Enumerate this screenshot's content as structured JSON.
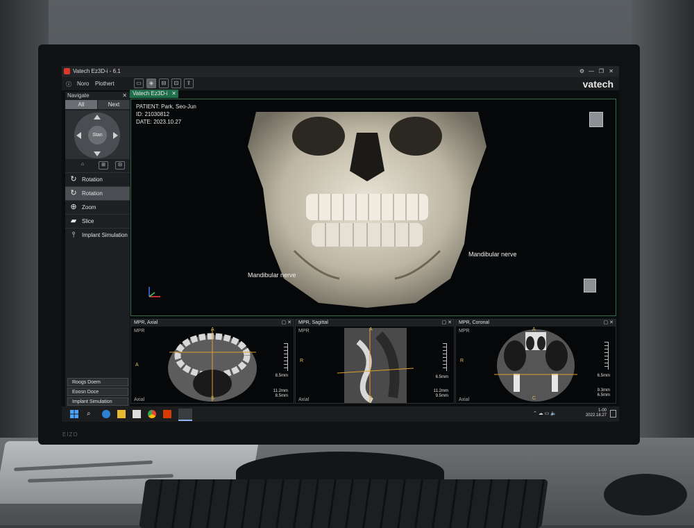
{
  "window": {
    "title": "Vatech Ez3D-i - 6.1",
    "brand": "vatech"
  },
  "menu": [
    "Noro",
    "Plothert"
  ],
  "doc_tab": "Vatech Ez3D-i",
  "sidebar": {
    "title": "Navigate",
    "tabs": [
      "All",
      "Next"
    ],
    "wheel_center": "Stan",
    "tools": [
      {
        "label": "Rotation",
        "icon": "rotate-icon"
      },
      {
        "label": "Rotation",
        "icon": "rotate-icon"
      },
      {
        "label": "Zoom",
        "icon": "zoom-icon"
      },
      {
        "label": "Slice",
        "icon": "slice-icon"
      },
      {
        "label": "Implant Simulation",
        "icon": "implant-icon"
      }
    ],
    "bottom_buttons": [
      "Roogs Doem",
      "Eoosn Doce",
      "Implant Simulation"
    ]
  },
  "patient": {
    "name_line": "PATIENT: Park, Seo-Jun",
    "id_line": "ID: 21030812",
    "date_line": "DATE: 2023.10.27"
  },
  "annotations": {
    "left": "Mandibular nerve",
    "right": "Mandibular nerve"
  },
  "mpr": [
    {
      "title": "MPR, Axial",
      "sub": "MPR",
      "bottom_label": "Axial",
      "side_left": "A",
      "top_mark": "A",
      "bottom_mark": "S",
      "meas": [
        "8.5mm",
        "11.2mm",
        "8.5mm"
      ]
    },
    {
      "title": "MPR, Sagittal",
      "sub": "MPR",
      "bottom_label": "Axial",
      "side_left": "R",
      "top_mark": "A",
      "bottom_mark": "S",
      "meas": [
        "6.5mm",
        "11.2mm",
        "9.5mm"
      ]
    },
    {
      "title": "MPR, Coronal",
      "sub": "MPR",
      "bottom_label": "Axial",
      "side_left": "R",
      "top_mark": "A",
      "bottom_mark": "C",
      "meas": [
        "6.5mm",
        "9.3mm",
        "6.5mm"
      ]
    }
  ],
  "taskbar": {
    "time": "1-00",
    "date": "2022.18.27"
  },
  "monitor_brand": "EIZO",
  "colors": {
    "accent_green": "#1f6f4a",
    "measure_line": "#e0a030"
  }
}
